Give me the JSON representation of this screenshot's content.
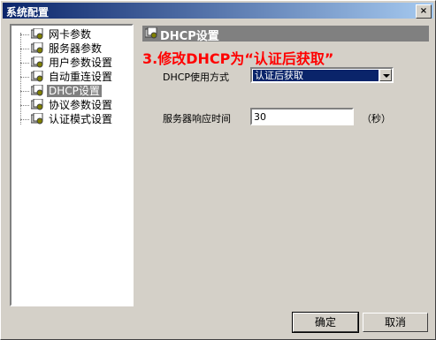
{
  "window": {
    "title": "系统配置",
    "close_symbol": "×"
  },
  "tree": {
    "items": [
      {
        "label": "网卡参数",
        "selected": false
      },
      {
        "label": "服务器参数",
        "selected": false
      },
      {
        "label": "用户参数设置",
        "selected": false
      },
      {
        "label": "自动重连设置",
        "selected": false
      },
      {
        "label": "DHCP设置",
        "selected": true
      },
      {
        "label": "协议参数设置",
        "selected": false
      },
      {
        "label": "认证模式设置",
        "selected": false
      }
    ]
  },
  "panel": {
    "title": "DHCP设置",
    "annotation": "3.修改DHCP为“认证后获取”",
    "dhcp_mode_label": "DHCP使用方式",
    "dhcp_mode_value": "认证后获取",
    "timeout_label": "服务器响应时间",
    "timeout_value": "30",
    "timeout_unit": "（秒）"
  },
  "buttons": {
    "ok": "确定",
    "cancel": "取消"
  },
  "colors": {
    "titlebar": "#0a246a",
    "annotation": "#ff0000",
    "selected": "#808080"
  }
}
